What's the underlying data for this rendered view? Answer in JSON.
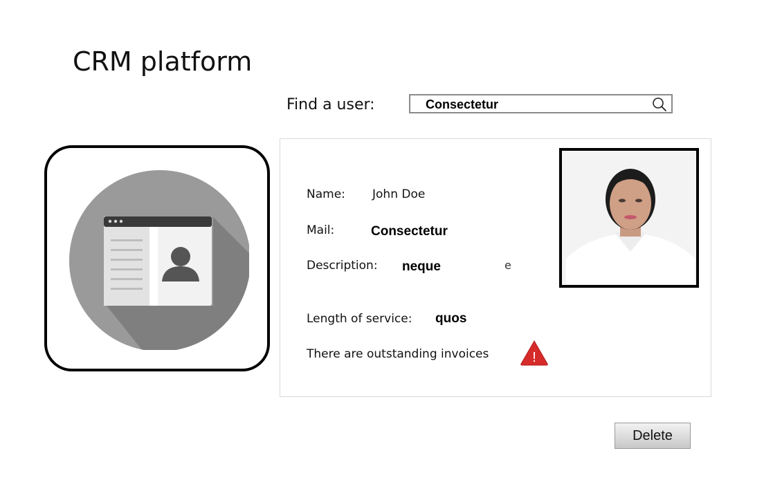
{
  "app": {
    "title": "CRM platform"
  },
  "search": {
    "label": "Find a user:",
    "value": "Consectetur",
    "icon": "search-icon"
  },
  "profile_card_icon": "contact-card-icon",
  "details": {
    "name_label": "Name:",
    "name_value": "John Doe",
    "mail_label": "Mail:",
    "mail_value": "Consectetur",
    "description_label": "Description:",
    "description_value": "neque",
    "description_trailing": "e",
    "service_label": "Length of service:",
    "service_value": "quos",
    "invoice_notice": "There are outstanding invoices",
    "warning_icon": "warning-icon",
    "warning_symbol": "!"
  },
  "photo": {
    "icon": "user-photo"
  },
  "actions": {
    "delete_label": "Delete"
  },
  "colors": {
    "warning": "#d62b2b",
    "card_circle": "#9a9a9a",
    "card_shadow": "#7f7f7f"
  }
}
